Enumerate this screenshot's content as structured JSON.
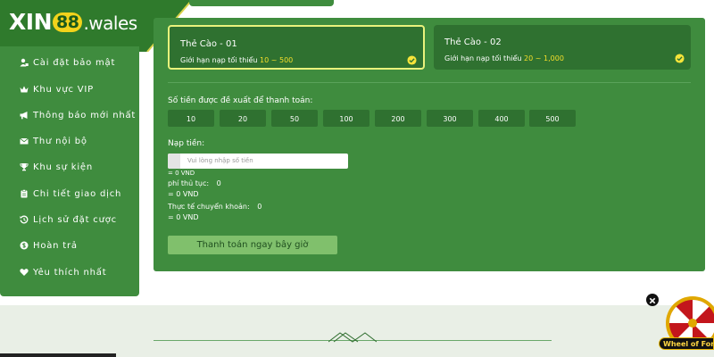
{
  "brand": {
    "name_prefix": "XIN",
    "name_num": "88",
    "domain": ".wales"
  },
  "sidebar": {
    "items": [
      {
        "label": "Cài đặt bảo mật",
        "icon": "user-lock-icon"
      },
      {
        "label": "Khu vực VIP",
        "icon": "crown-icon"
      },
      {
        "label": "Thông báo mới nhất",
        "icon": "megaphone-icon"
      },
      {
        "label": "Thư nội bộ",
        "icon": "envelope-icon"
      },
      {
        "label": "Khu sự kiện",
        "icon": "trophy-icon"
      },
      {
        "label": "Chi tiết giao dịch",
        "icon": "clipboard-icon"
      },
      {
        "label": "Lịch sử đặt cược",
        "icon": "history-icon"
      },
      {
        "label": "Hoàn trả",
        "icon": "dollar-circle-icon"
      },
      {
        "label": "Yêu thích nhất",
        "icon": "heart-icon"
      }
    ]
  },
  "cards": [
    {
      "title": "Thẻ Cào - 01",
      "limit_prefix": "Giới hạn nạp tối thiểu",
      "limit_range": "10 ~ 500",
      "active": true
    },
    {
      "title": "Thẻ Cào - 02",
      "limit_prefix": "Giới hạn nạp tối thiểu",
      "limit_range": "20 ~ 1,000",
      "active": false
    }
  ],
  "suggest_label": "Số tiền được đề xuất để thanh toán:",
  "amounts": [
    "10",
    "20",
    "50",
    "100",
    "200",
    "300",
    "400",
    "500"
  ],
  "deposit": {
    "label": "Nạp tiền:",
    "placeholder": "Vui lòng nhập số tiền",
    "converted": "= 0 VND",
    "fee_label": "phí thủ tục:",
    "fee_value": "0",
    "fee_converted": "= 0 VND",
    "actual_label": "Thực tế chuyển khoản:",
    "actual_value": "0",
    "actual_converted": "= 0 VND"
  },
  "pay_button": "Thanh toán ngay bây giờ",
  "wheel": {
    "label": "Wheel of Fortune"
  },
  "colors": {
    "primary": "#3f8c3e",
    "dark": "#2f7130",
    "highlight": "#f6df2a",
    "button": "#80c06c"
  }
}
